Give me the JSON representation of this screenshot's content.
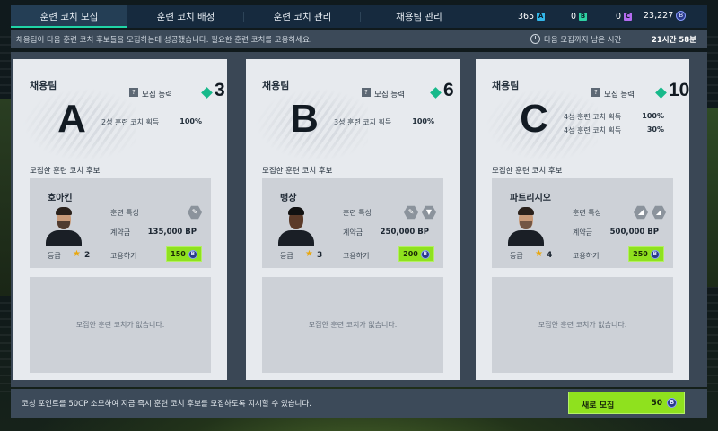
{
  "tabs": [
    {
      "label": "훈련 코치 모집",
      "active": true
    },
    {
      "label": "훈련 코치 배정",
      "active": false
    },
    {
      "label": "훈련 코치 관리",
      "active": false
    },
    {
      "label": "채용팀 관리",
      "active": false
    }
  ],
  "currencies": {
    "a": {
      "value": "365",
      "chip": "A",
      "color": "#33b6e8"
    },
    "b": {
      "value": "0",
      "chip": "B",
      "color": "#2fd1a3"
    },
    "c": {
      "value": "0",
      "chip": "C",
      "color": "#b36cf0"
    },
    "bp": {
      "value": "23,227",
      "coin": "B"
    }
  },
  "notice": {
    "message": "채용팀이 다음 훈련 코치 후보들을 모집하는데 성공했습니다. 필요한 훈련 코치를 고용하세요.",
    "time_label": "다음 모집까지 남은 시간",
    "time_value": "21시간 58분"
  },
  "teams": [
    {
      "header": "채용팀",
      "letter": "A",
      "ability_label": "모집 능력",
      "level": "3",
      "rates": [
        {
          "label": "2성 훈련 코치 획득",
          "value": "100%"
        }
      ],
      "cand_title": "모집한 훈련 코치 후보",
      "candidate": {
        "name": "호아킨",
        "trait_label": "훈련 특성",
        "traits": [
          "shield-icon"
        ],
        "fee_label": "계약금",
        "fee": "135,000 BP",
        "grade_label": "등급",
        "grade": "2",
        "hire_label": "고용하기",
        "hire_cost": "150",
        "coin": "B"
      },
      "empty_text": "모집한 훈련 코치가 없습니다."
    },
    {
      "header": "채용팀",
      "letter": "B",
      "ability_label": "모집 능력",
      "level": "6",
      "rates": [
        {
          "label": "3성 훈련 코치 획득",
          "value": "100%"
        }
      ],
      "cand_title": "모집한 훈련 코치 후보",
      "candidate": {
        "name": "뱅상",
        "trait_label": "훈련 특성",
        "traits": [
          "shield-icon",
          "shirt-icon"
        ],
        "fee_label": "계약금",
        "fee": "250,000 BP",
        "grade_label": "등급",
        "grade": "3",
        "hire_label": "고용하기",
        "hire_cost": "200",
        "coin": "B"
      },
      "empty_text": "모집한 훈련 코치가 없습니다."
    },
    {
      "header": "채용팀",
      "letter": "C",
      "ability_label": "모집 능력",
      "level": "10",
      "rates": [
        {
          "label": "4성 훈련 코치 획득",
          "value": "100%"
        },
        {
          "label": "4성 훈련 코치 획득",
          "value": "30%"
        }
      ],
      "cand_title": "모집한 훈련 코치 후보",
      "candidate": {
        "name": "파트리시오",
        "trait_label": "훈련 특성",
        "traits": [
          "boot-icon",
          "boot-icon"
        ],
        "fee_label": "계약금",
        "fee": "500,000 BP",
        "grade_label": "등급",
        "grade": "4",
        "hire_label": "고용하기",
        "hire_cost": "250",
        "coin": "B"
      },
      "empty_text": "모집한 훈련 코치가 없습니다."
    }
  ],
  "bottom": {
    "message": "코칭 포인트를 50CP 소모하여 지금 즉시 훈련 코치 후보를 모집하도록 지시할 수 있습니다.",
    "recruit_label": "새로 모집",
    "recruit_cost": "50",
    "coin": "B"
  }
}
